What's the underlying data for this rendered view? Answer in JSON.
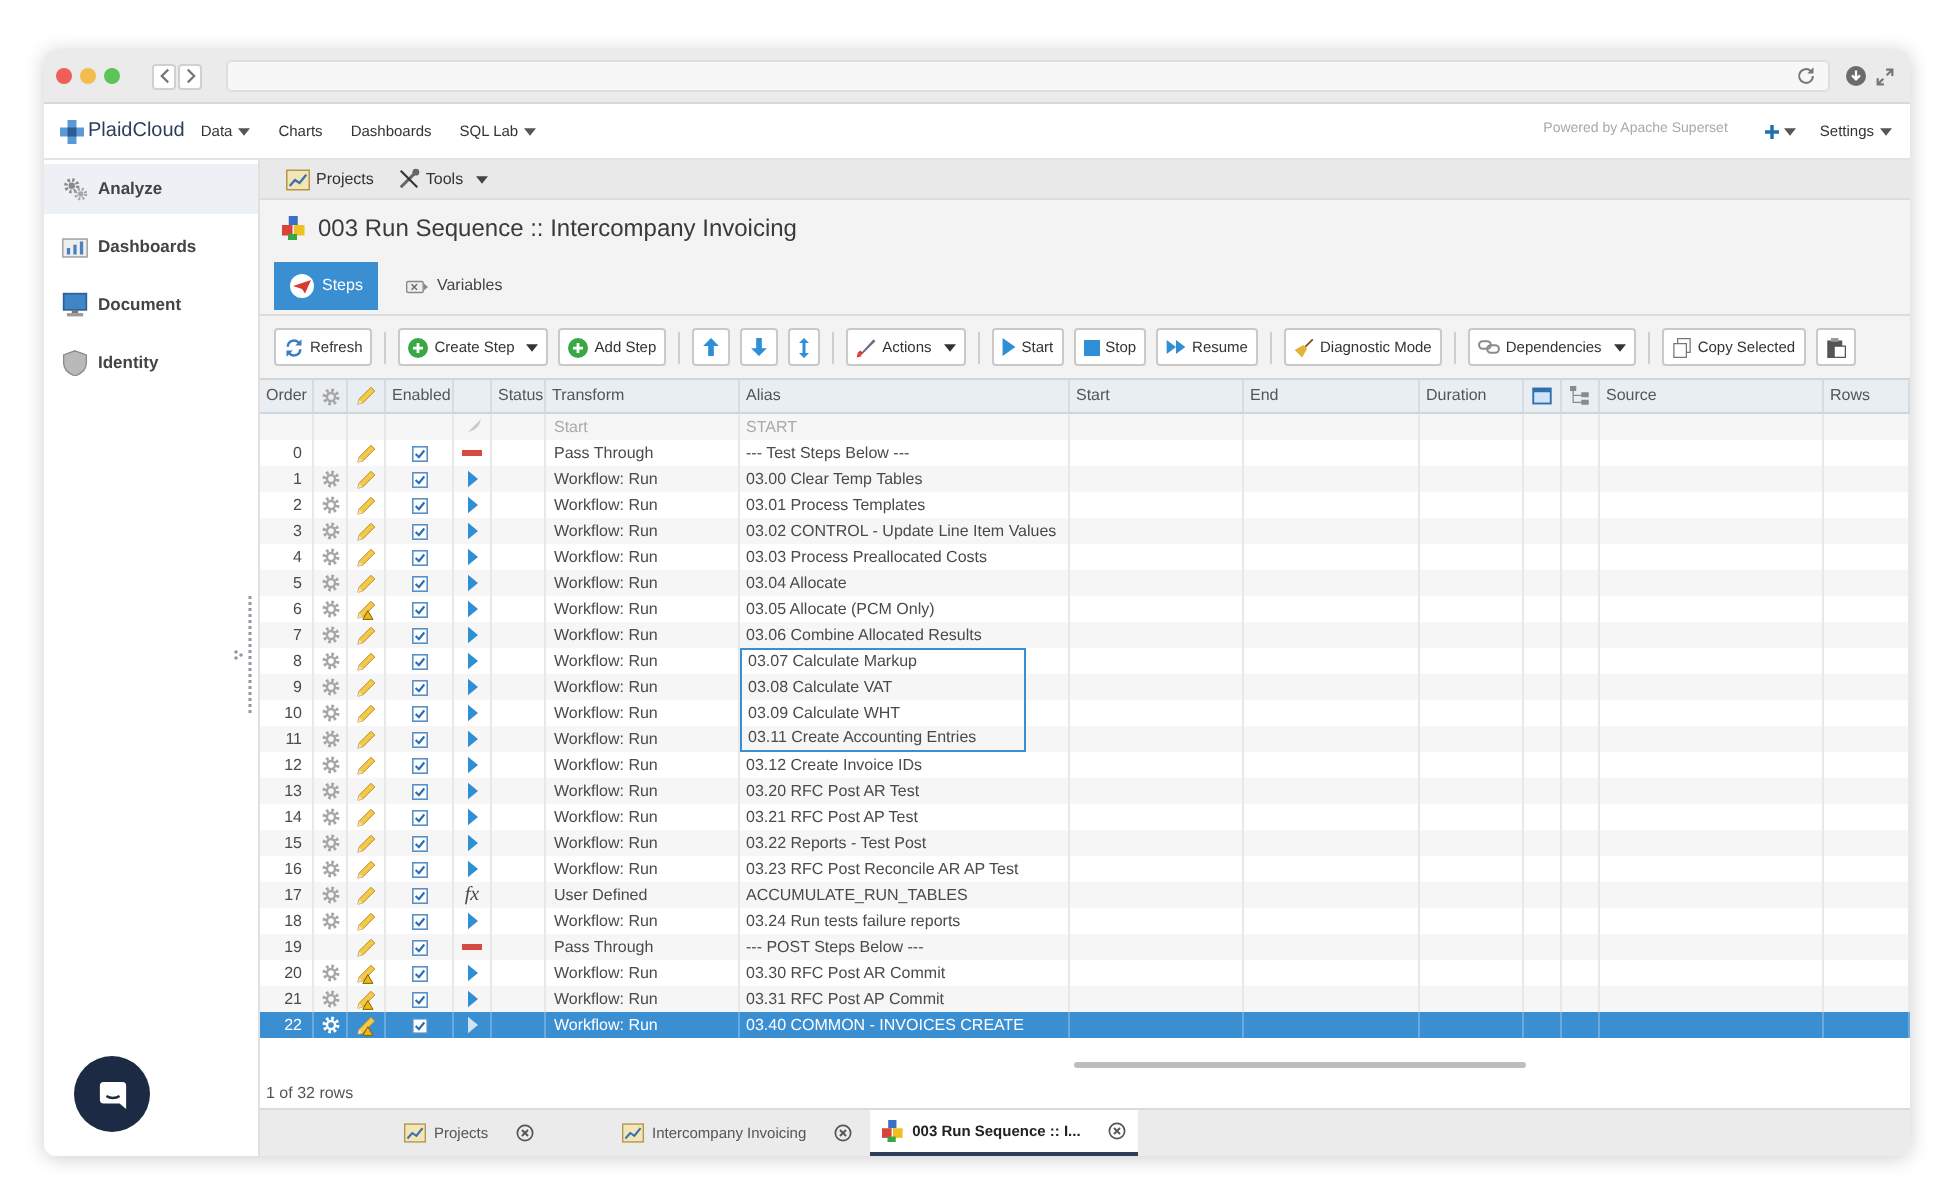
{
  "navbar": {
    "logo": "PlaidCloud",
    "menu": [
      {
        "label": "Data",
        "dropdown": true
      },
      {
        "label": "Charts"
      },
      {
        "label": "Dashboards"
      },
      {
        "label": "SQL Lab",
        "dropdown": true
      }
    ],
    "powered_by": "Powered by Apache Superset",
    "settings": {
      "label": "Settings",
      "dropdown": true
    }
  },
  "sidebar": {
    "items": [
      {
        "kind": "gears",
        "label": "Analyze",
        "selected": true
      },
      {
        "kind": "chart",
        "label": "Dashboards",
        "selected": false
      },
      {
        "kind": "monitor",
        "label": "Document",
        "selected": false
      },
      {
        "kind": "shield",
        "label": "Identity",
        "selected": false
      }
    ]
  },
  "menu_bar": [
    {
      "kind": "chart",
      "label": "Projects"
    },
    {
      "kind": "tools",
      "label": "Tools",
      "dropdown": true
    }
  ],
  "title": "003 Run Sequence :: Intercompany Invoicing",
  "tabs": [
    {
      "kind": "steps",
      "label": "Steps",
      "selected": true
    },
    {
      "kind": "variables",
      "label": "Variables",
      "selected": false
    }
  ],
  "toolbar": {
    "groups": [
      {
        "buttons": [
          {
            "kind": "refresh",
            "label": "Refresh"
          }
        ]
      },
      {
        "buttons": [
          {
            "kind": "create",
            "label": "Create Step",
            "dropdown": true
          },
          {
            "kind": "add",
            "label": "Add Step"
          }
        ]
      },
      {
        "buttons": [
          {
            "kind": "up"
          },
          {
            "kind": "down"
          },
          {
            "kind": "updown"
          }
        ]
      },
      {
        "buttons": [
          {
            "kind": "actions",
            "label": "Actions",
            "dropdown": true
          }
        ]
      },
      {
        "buttons": [
          {
            "kind": "start",
            "label": "Start"
          },
          {
            "kind": "stop",
            "label": "Stop"
          },
          {
            "kind": "resume",
            "label": "Resume"
          }
        ]
      },
      {
        "buttons": [
          {
            "kind": "diagnostic",
            "label": "Diagnostic Mode"
          }
        ]
      },
      {
        "buttons": [
          {
            "kind": "dependencies",
            "label": "Dependencies",
            "dropdown": true
          }
        ]
      },
      {
        "buttons": [
          {
            "kind": "copy",
            "label": "Copy Selected"
          },
          {
            "kind": "paste"
          }
        ]
      }
    ]
  },
  "table": {
    "columns": [
      {
        "kind": "text",
        "label": "Order"
      },
      {
        "kind": "gear"
      },
      {
        "kind": "pencil"
      },
      {
        "kind": "text",
        "label": "Enabled"
      },
      {
        "kind": "empty"
      },
      {
        "kind": "text",
        "label": "Status"
      },
      {
        "kind": "text",
        "label": "Transform"
      },
      {
        "kind": "text",
        "label": "Alias"
      },
      {
        "kind": "text",
        "label": "Start"
      },
      {
        "kind": "text",
        "label": "End"
      },
      {
        "kind": "text",
        "label": "Duration"
      },
      {
        "kind": "window"
      },
      {
        "kind": "tree"
      },
      {
        "kind": "text",
        "label": "Source"
      },
      {
        "kind": "text",
        "label": "Rows"
      }
    ],
    "rows": [
      {
        "kind": "start",
        "transform": "Start",
        "alias": "START",
        "selected": false,
        "in_range": false
      },
      {
        "kind": "step",
        "order": "0",
        "gear": false,
        "warning": false,
        "enabled": true,
        "status": {
          "kind": "pass"
        },
        "transform": "Pass Through",
        "alias": "--- Test Steps Below ---",
        "selected": false,
        "in_range": false
      },
      {
        "kind": "step",
        "order": "1",
        "gear": true,
        "warning": false,
        "enabled": true,
        "status": {
          "kind": "run"
        },
        "transform": "Workflow: Run",
        "alias": "03.00 Clear Temp Tables",
        "selected": false,
        "in_range": false
      },
      {
        "kind": "step",
        "order": "2",
        "gear": true,
        "warning": false,
        "enabled": true,
        "status": {
          "kind": "run"
        },
        "transform": "Workflow: Run",
        "alias": "03.01 Process Templates",
        "selected": false,
        "in_range": false
      },
      {
        "kind": "step",
        "order": "3",
        "gear": true,
        "warning": false,
        "enabled": true,
        "status": {
          "kind": "run"
        },
        "transform": "Workflow: Run",
        "alias": "03.02 CONTROL - Update Line Item Values",
        "selected": false,
        "in_range": false
      },
      {
        "kind": "step",
        "order": "4",
        "gear": true,
        "warning": false,
        "enabled": true,
        "status": {
          "kind": "run"
        },
        "transform": "Workflow: Run",
        "alias": "03.03 Process Preallocated Costs",
        "selected": false,
        "in_range": false
      },
      {
        "kind": "step",
        "order": "5",
        "gear": true,
        "warning": false,
        "enabled": true,
        "status": {
          "kind": "run"
        },
        "transform": "Workflow: Run",
        "alias": "03.04 Allocate",
        "selected": false,
        "in_range": false
      },
      {
        "kind": "step",
        "order": "6",
        "gear": true,
        "warning": true,
        "enabled": true,
        "status": {
          "kind": "run"
        },
        "transform": "Workflow: Run",
        "alias": "03.05 Allocate (PCM Only)",
        "selected": false,
        "in_range": false
      },
      {
        "kind": "step",
        "order": "7",
        "gear": true,
        "warning": false,
        "enabled": true,
        "status": {
          "kind": "run"
        },
        "transform": "Workflow: Run",
        "alias": "03.06 Combine Allocated Results",
        "selected": false,
        "in_range": false
      },
      {
        "kind": "step",
        "order": "8",
        "gear": true,
        "warning": false,
        "enabled": true,
        "status": {
          "kind": "run"
        },
        "transform": "Workflow: Run",
        "alias": "03.07 Calculate Markup",
        "selected": false,
        "in_range": true
      },
      {
        "kind": "step",
        "order": "9",
        "gear": true,
        "warning": false,
        "enabled": true,
        "status": {
          "kind": "run"
        },
        "transform": "Workflow: Run",
        "alias": "03.08 Calculate VAT",
        "selected": false,
        "in_range": true
      },
      {
        "kind": "step",
        "order": "10",
        "gear": true,
        "warning": false,
        "enabled": true,
        "status": {
          "kind": "run"
        },
        "transform": "Workflow: Run",
        "alias": "03.09 Calculate WHT",
        "selected": false,
        "in_range": true
      },
      {
        "kind": "step",
        "order": "11",
        "gear": true,
        "warning": false,
        "enabled": true,
        "status": {
          "kind": "run"
        },
        "transform": "Workflow: Run",
        "alias": "03.11 Create Accounting Entries",
        "selected": false,
        "in_range": true
      },
      {
        "kind": "step",
        "order": "12",
        "gear": true,
        "warning": false,
        "enabled": true,
        "status": {
          "kind": "run"
        },
        "transform": "Workflow: Run",
        "alias": "03.12 Create Invoice IDs",
        "selected": false,
        "in_range": false
      },
      {
        "kind": "step",
        "order": "13",
        "gear": true,
        "warning": false,
        "enabled": true,
        "status": {
          "kind": "run"
        },
        "transform": "Workflow: Run",
        "alias": "03.20 RFC Post AR Test",
        "selected": false,
        "in_range": false
      },
      {
        "kind": "step",
        "order": "14",
        "gear": true,
        "warning": false,
        "enabled": true,
        "status": {
          "kind": "run"
        },
        "transform": "Workflow: Run",
        "alias": "03.21 RFC Post AP Test",
        "selected": false,
        "in_range": false
      },
      {
        "kind": "step",
        "order": "15",
        "gear": true,
        "warning": false,
        "enabled": true,
        "status": {
          "kind": "run"
        },
        "transform": "Workflow: Run",
        "alias": "03.22 Reports - Test Post",
        "selected": false,
        "in_range": false
      },
      {
        "kind": "step",
        "order": "16",
        "gear": true,
        "warning": false,
        "enabled": true,
        "status": {
          "kind": "run"
        },
        "transform": "Workflow: Run",
        "alias": "03.23 RFC Post Reconcile AR AP Test",
        "selected": false,
        "in_range": false
      },
      {
        "kind": "step",
        "order": "17",
        "gear": true,
        "warning": false,
        "enabled": true,
        "status": {
          "kind": "function",
          "symbol": "fx"
        },
        "transform": "User Defined",
        "alias": "ACCUMULATE_RUN_TABLES",
        "selected": false,
        "in_range": false
      },
      {
        "kind": "step",
        "order": "18",
        "gear": true,
        "warning": false,
        "enabled": true,
        "status": {
          "kind": "run"
        },
        "transform": "Workflow: Run",
        "alias": "03.24 Run tests failure reports",
        "selected": false,
        "in_range": false
      },
      {
        "kind": "step",
        "order": "19",
        "gear": false,
        "warning": false,
        "enabled": true,
        "status": {
          "kind": "pass"
        },
        "transform": "Pass Through",
        "alias": "--- POST Steps Below ---",
        "selected": false,
        "in_range": false
      },
      {
        "kind": "step",
        "order": "20",
        "gear": true,
        "warning": true,
        "enabled": true,
        "status": {
          "kind": "run"
        },
        "transform": "Workflow: Run",
        "alias": "03.30 RFC Post AR Commit",
        "selected": false,
        "in_range": false
      },
      {
        "kind": "step",
        "order": "21",
        "gear": true,
        "warning": true,
        "enabled": true,
        "status": {
          "kind": "run"
        },
        "transform": "Workflow: Run",
        "alias": "03.31 RFC Post AP Commit",
        "selected": false,
        "in_range": false
      },
      {
        "kind": "step",
        "order": "22",
        "gear": true,
        "warning": true,
        "enabled": true,
        "status": {
          "kind": "run"
        },
        "transform": "Workflow: Run",
        "alias": "03.40 COMMON - INVOICES CREATE",
        "selected": true,
        "in_range": false
      }
    ]
  },
  "footer": {
    "row_count": "1 of 32 rows"
  },
  "bottom_tabs": [
    {
      "kind": "chart",
      "label": "Projects",
      "selected": false
    },
    {
      "kind": "chart",
      "label": "Intercompany Invoicing",
      "selected": false
    },
    {
      "kind": "sequence",
      "label": "003 Run Sequence :: I...",
      "selected": true
    }
  ]
}
